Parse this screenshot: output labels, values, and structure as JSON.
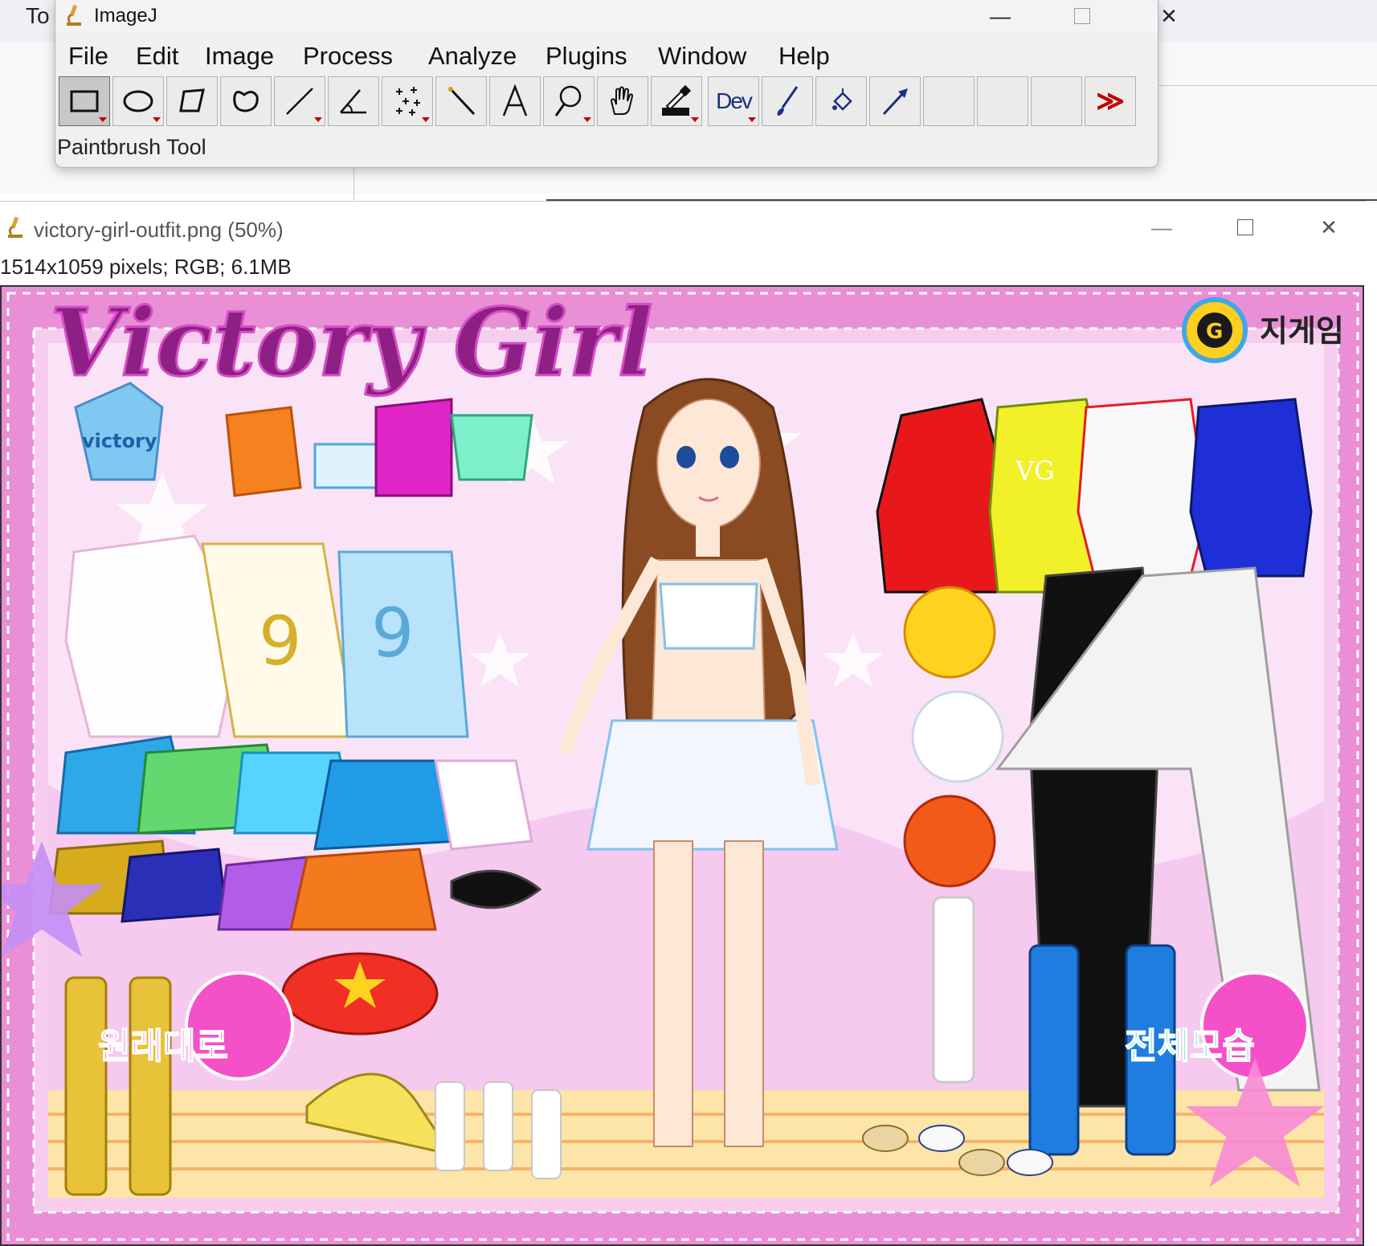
{
  "background_app": {
    "partial_label": "To"
  },
  "imagej": {
    "title": "ImageJ",
    "menu": [
      "File",
      "Edit",
      "Image",
      "Process",
      "Analyze",
      "Plugins",
      "Window",
      "Help"
    ],
    "tools": [
      "rectangle-tool",
      "oval-tool",
      "polygon-tool",
      "freehand-tool",
      "line-tool",
      "angle-tool",
      "multi-point-tool",
      "wand-tool",
      "text-tool",
      "magnifier-tool",
      "hand-tool",
      "color-picker-tool",
      "dev-menu",
      "paintbrush-tool",
      "flood-fill-tool",
      "arrow-tool",
      "empty-slot-1",
      "empty-slot-2",
      "empty-slot-3",
      "more-tools"
    ],
    "dev_label": "Dev",
    "more_label": "≫",
    "status": "Paintbrush Tool"
  },
  "image_window": {
    "title": "victory-girl-outfit.png (50%)",
    "info": "1514x1059 pixels; RGB; 6.1MB"
  },
  "game": {
    "title": "Victory Girl",
    "logo_text": "지게임",
    "logo_letter": "G",
    "reset_button": "원래대로",
    "view_all_button": "전체모습",
    "shirt_numbers": [
      "9",
      "9"
    ],
    "vest_label": "victory",
    "dress_label": "VG"
  },
  "colors": {
    "frame_pink": "#e98fd6",
    "inner_pink": "#f6cdef",
    "title_purple": "#8e1f85",
    "floor_yellow": "#fde4a8"
  }
}
